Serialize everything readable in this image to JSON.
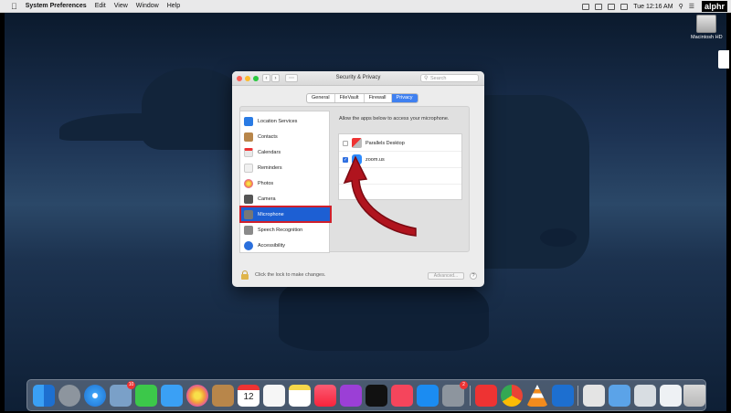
{
  "menubar": {
    "app_name": "System Preferences",
    "items": [
      "Edit",
      "View",
      "Window",
      "Help"
    ],
    "clock": "Tue 12:16 AM",
    "brand": "alphr"
  },
  "desktop": {
    "drive_label": "Macintosh HD"
  },
  "window": {
    "title": "Security & Privacy",
    "search_placeholder": "Search",
    "tabs": [
      "General",
      "FileVault",
      "Firewall",
      "Privacy"
    ],
    "active_tab": "Privacy",
    "services": [
      {
        "label": "Location Services",
        "icon": "location-arrow-icon",
        "color": "#2a7be4"
      },
      {
        "label": "Contacts",
        "icon": "contacts-book-icon",
        "color": "#b8864a"
      },
      {
        "label": "Calendars",
        "icon": "calendar-icon",
        "color": "#e8e8e8"
      },
      {
        "label": "Reminders",
        "icon": "reminders-list-icon",
        "color": "#f0f0f0"
      },
      {
        "label": "Photos",
        "icon": "photos-flower-icon",
        "color": "#f3a13a"
      },
      {
        "label": "Camera",
        "icon": "camera-icon",
        "color": "#555555"
      },
      {
        "label": "Microphone",
        "icon": "microphone-icon",
        "color": "#777777"
      },
      {
        "label": "Speech Recognition",
        "icon": "speech-waveform-icon",
        "color": "#8a8a8a"
      },
      {
        "label": "Accessibility",
        "icon": "accessibility-person-icon",
        "color": "#2a6fdc"
      }
    ],
    "selected_service": "Microphone",
    "allow_text": "Allow the apps below to access your microphone.",
    "apps": [
      {
        "label": "Parallels Desktop",
        "checked": false,
        "icon": "parallels-icon"
      },
      {
        "label": "zoom.us",
        "checked": true,
        "icon": "zoom-camera-icon"
      }
    ],
    "lock_text": "Click the lock to make changes.",
    "advanced_label": "Advanced...",
    "help_label": "?"
  },
  "dock": {
    "badges": {
      "mail": "10",
      "system_prefs": "2"
    },
    "calendar_day": "12"
  },
  "colors": {
    "accent": "#1d5fd3",
    "highlight_outline": "#d0202c",
    "arrow": "#b0141e"
  }
}
